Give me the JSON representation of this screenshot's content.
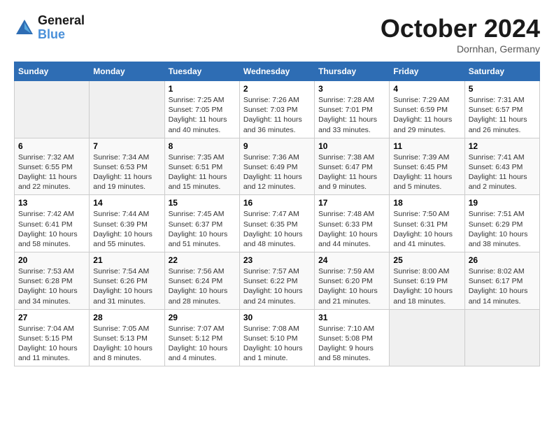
{
  "header": {
    "logo_line1": "General",
    "logo_line2": "Blue",
    "month": "October 2024",
    "location": "Dornhan, Germany"
  },
  "weekdays": [
    "Sunday",
    "Monday",
    "Tuesday",
    "Wednesday",
    "Thursday",
    "Friday",
    "Saturday"
  ],
  "weeks": [
    [
      {
        "day": "",
        "sunrise": "",
        "sunset": "",
        "daylight": "",
        "empty": true
      },
      {
        "day": "",
        "sunrise": "",
        "sunset": "",
        "daylight": "",
        "empty": true
      },
      {
        "day": "1",
        "sunrise": "Sunrise: 7:25 AM",
        "sunset": "Sunset: 7:05 PM",
        "daylight": "Daylight: 11 hours and 40 minutes.",
        "empty": false
      },
      {
        "day": "2",
        "sunrise": "Sunrise: 7:26 AM",
        "sunset": "Sunset: 7:03 PM",
        "daylight": "Daylight: 11 hours and 36 minutes.",
        "empty": false
      },
      {
        "day": "3",
        "sunrise": "Sunrise: 7:28 AM",
        "sunset": "Sunset: 7:01 PM",
        "daylight": "Daylight: 11 hours and 33 minutes.",
        "empty": false
      },
      {
        "day": "4",
        "sunrise": "Sunrise: 7:29 AM",
        "sunset": "Sunset: 6:59 PM",
        "daylight": "Daylight: 11 hours and 29 minutes.",
        "empty": false
      },
      {
        "day": "5",
        "sunrise": "Sunrise: 7:31 AM",
        "sunset": "Sunset: 6:57 PM",
        "daylight": "Daylight: 11 hours and 26 minutes.",
        "empty": false
      }
    ],
    [
      {
        "day": "6",
        "sunrise": "Sunrise: 7:32 AM",
        "sunset": "Sunset: 6:55 PM",
        "daylight": "Daylight: 11 hours and 22 minutes.",
        "empty": false
      },
      {
        "day": "7",
        "sunrise": "Sunrise: 7:34 AM",
        "sunset": "Sunset: 6:53 PM",
        "daylight": "Daylight: 11 hours and 19 minutes.",
        "empty": false
      },
      {
        "day": "8",
        "sunrise": "Sunrise: 7:35 AM",
        "sunset": "Sunset: 6:51 PM",
        "daylight": "Daylight: 11 hours and 15 minutes.",
        "empty": false
      },
      {
        "day": "9",
        "sunrise": "Sunrise: 7:36 AM",
        "sunset": "Sunset: 6:49 PM",
        "daylight": "Daylight: 11 hours and 12 minutes.",
        "empty": false
      },
      {
        "day": "10",
        "sunrise": "Sunrise: 7:38 AM",
        "sunset": "Sunset: 6:47 PM",
        "daylight": "Daylight: 11 hours and 9 minutes.",
        "empty": false
      },
      {
        "day": "11",
        "sunrise": "Sunrise: 7:39 AM",
        "sunset": "Sunset: 6:45 PM",
        "daylight": "Daylight: 11 hours and 5 minutes.",
        "empty": false
      },
      {
        "day": "12",
        "sunrise": "Sunrise: 7:41 AM",
        "sunset": "Sunset: 6:43 PM",
        "daylight": "Daylight: 11 hours and 2 minutes.",
        "empty": false
      }
    ],
    [
      {
        "day": "13",
        "sunrise": "Sunrise: 7:42 AM",
        "sunset": "Sunset: 6:41 PM",
        "daylight": "Daylight: 10 hours and 58 minutes.",
        "empty": false
      },
      {
        "day": "14",
        "sunrise": "Sunrise: 7:44 AM",
        "sunset": "Sunset: 6:39 PM",
        "daylight": "Daylight: 10 hours and 55 minutes.",
        "empty": false
      },
      {
        "day": "15",
        "sunrise": "Sunrise: 7:45 AM",
        "sunset": "Sunset: 6:37 PM",
        "daylight": "Daylight: 10 hours and 51 minutes.",
        "empty": false
      },
      {
        "day": "16",
        "sunrise": "Sunrise: 7:47 AM",
        "sunset": "Sunset: 6:35 PM",
        "daylight": "Daylight: 10 hours and 48 minutes.",
        "empty": false
      },
      {
        "day": "17",
        "sunrise": "Sunrise: 7:48 AM",
        "sunset": "Sunset: 6:33 PM",
        "daylight": "Daylight: 10 hours and 44 minutes.",
        "empty": false
      },
      {
        "day": "18",
        "sunrise": "Sunrise: 7:50 AM",
        "sunset": "Sunset: 6:31 PM",
        "daylight": "Daylight: 10 hours and 41 minutes.",
        "empty": false
      },
      {
        "day": "19",
        "sunrise": "Sunrise: 7:51 AM",
        "sunset": "Sunset: 6:29 PM",
        "daylight": "Daylight: 10 hours and 38 minutes.",
        "empty": false
      }
    ],
    [
      {
        "day": "20",
        "sunrise": "Sunrise: 7:53 AM",
        "sunset": "Sunset: 6:28 PM",
        "daylight": "Daylight: 10 hours and 34 minutes.",
        "empty": false
      },
      {
        "day": "21",
        "sunrise": "Sunrise: 7:54 AM",
        "sunset": "Sunset: 6:26 PM",
        "daylight": "Daylight: 10 hours and 31 minutes.",
        "empty": false
      },
      {
        "day": "22",
        "sunrise": "Sunrise: 7:56 AM",
        "sunset": "Sunset: 6:24 PM",
        "daylight": "Daylight: 10 hours and 28 minutes.",
        "empty": false
      },
      {
        "day": "23",
        "sunrise": "Sunrise: 7:57 AM",
        "sunset": "Sunset: 6:22 PM",
        "daylight": "Daylight: 10 hours and 24 minutes.",
        "empty": false
      },
      {
        "day": "24",
        "sunrise": "Sunrise: 7:59 AM",
        "sunset": "Sunset: 6:20 PM",
        "daylight": "Daylight: 10 hours and 21 minutes.",
        "empty": false
      },
      {
        "day": "25",
        "sunrise": "Sunrise: 8:00 AM",
        "sunset": "Sunset: 6:19 PM",
        "daylight": "Daylight: 10 hours and 18 minutes.",
        "empty": false
      },
      {
        "day": "26",
        "sunrise": "Sunrise: 8:02 AM",
        "sunset": "Sunset: 6:17 PM",
        "daylight": "Daylight: 10 hours and 14 minutes.",
        "empty": false
      }
    ],
    [
      {
        "day": "27",
        "sunrise": "Sunrise: 7:04 AM",
        "sunset": "Sunset: 5:15 PM",
        "daylight": "Daylight: 10 hours and 11 minutes.",
        "empty": false
      },
      {
        "day": "28",
        "sunrise": "Sunrise: 7:05 AM",
        "sunset": "Sunset: 5:13 PM",
        "daylight": "Daylight: 10 hours and 8 minutes.",
        "empty": false
      },
      {
        "day": "29",
        "sunrise": "Sunrise: 7:07 AM",
        "sunset": "Sunset: 5:12 PM",
        "daylight": "Daylight: 10 hours and 4 minutes.",
        "empty": false
      },
      {
        "day": "30",
        "sunrise": "Sunrise: 7:08 AM",
        "sunset": "Sunset: 5:10 PM",
        "daylight": "Daylight: 10 hours and 1 minute.",
        "empty": false
      },
      {
        "day": "31",
        "sunrise": "Sunrise: 7:10 AM",
        "sunset": "Sunset: 5:08 PM",
        "daylight": "Daylight: 9 hours and 58 minutes.",
        "empty": false
      },
      {
        "day": "",
        "sunrise": "",
        "sunset": "",
        "daylight": "",
        "empty": true
      },
      {
        "day": "",
        "sunrise": "",
        "sunset": "",
        "daylight": "",
        "empty": true
      }
    ]
  ]
}
